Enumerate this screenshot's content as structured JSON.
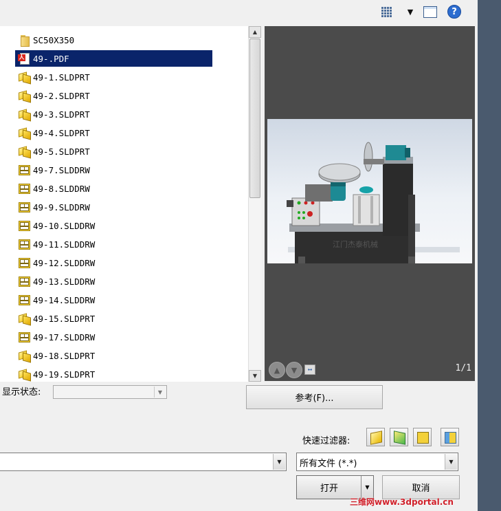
{
  "toolbar": {
    "icons": [
      "view-grid-icon",
      "dropdown-arrow-icon",
      "preview-pane-icon",
      "help-icon"
    ],
    "help_glyph": "?"
  },
  "file_list": {
    "items": [
      {
        "name": "SC50X350",
        "type": "folder"
      },
      {
        "name": "49-.PDF",
        "type": "pdf",
        "selected": true
      },
      {
        "name": "49-1.SLDPRT",
        "type": "part"
      },
      {
        "name": "49-2.SLDPRT",
        "type": "part"
      },
      {
        "name": "49-3.SLDPRT",
        "type": "part"
      },
      {
        "name": "49-4.SLDPRT",
        "type": "part"
      },
      {
        "name": "49-5.SLDPRT",
        "type": "part"
      },
      {
        "name": "49-7.SLDDRW",
        "type": "drawing"
      },
      {
        "name": "49-8.SLDDRW",
        "type": "drawing"
      },
      {
        "name": "49-9.SLDDRW",
        "type": "drawing"
      },
      {
        "name": "49-10.SLDDRW",
        "type": "drawing"
      },
      {
        "name": "49-11.SLDDRW",
        "type": "drawing"
      },
      {
        "name": "49-12.SLDDRW",
        "type": "drawing"
      },
      {
        "name": "49-13.SLDDRW",
        "type": "drawing"
      },
      {
        "name": "49-14.SLDDRW",
        "type": "drawing"
      },
      {
        "name": "49-15.SLDPRT",
        "type": "part"
      },
      {
        "name": "49-17.SLDDRW",
        "type": "drawing"
      },
      {
        "name": "49-18.SLDPRT",
        "type": "part"
      },
      {
        "name": "49-19.SLDPRT",
        "type": "part"
      }
    ]
  },
  "preview": {
    "machine_label": "江门杰泰机械",
    "page_indicator": "1/1"
  },
  "display_state": {
    "label": "显示状态:",
    "value": ""
  },
  "reference_button": "参考(F)...",
  "quick_filter": {
    "label": "快速过滤器:"
  },
  "filename": {
    "value": ""
  },
  "file_type": {
    "selected": "所有文件 (*.*)"
  },
  "buttons": {
    "open": "打开",
    "cancel": "取消"
  },
  "watermark": "三维网www.3dportal.cn"
}
